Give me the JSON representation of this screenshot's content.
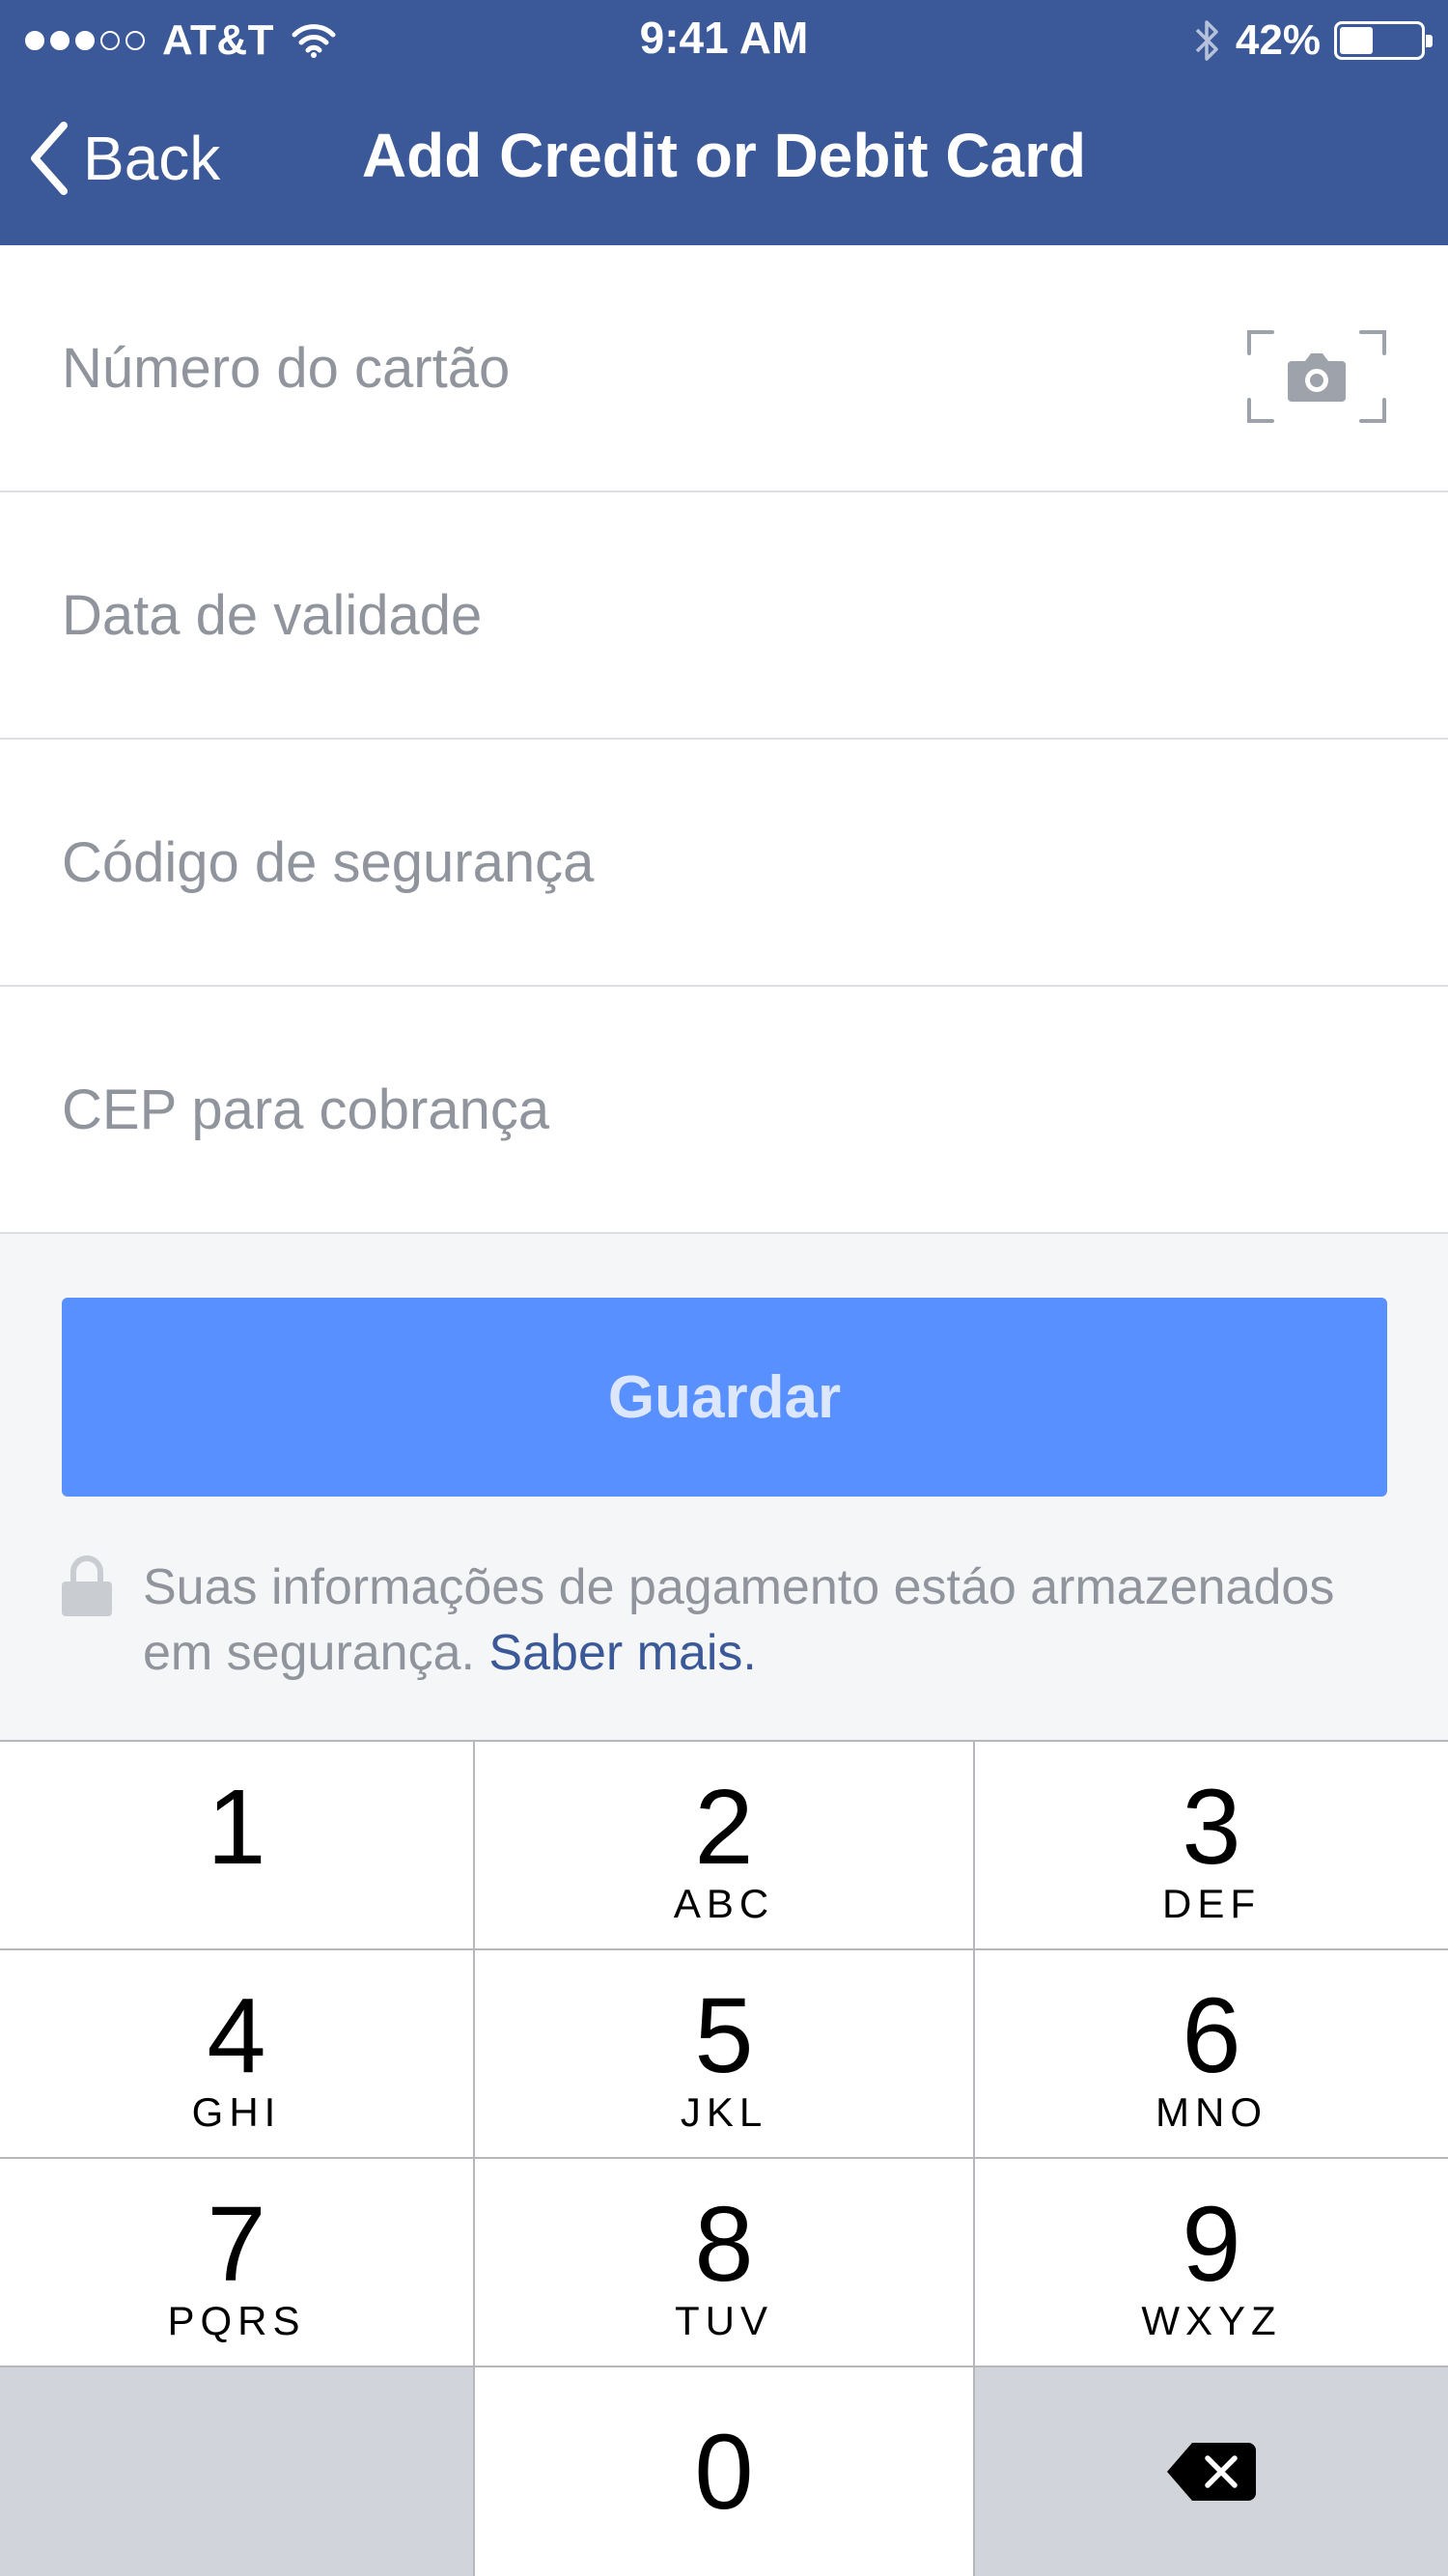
{
  "status_bar": {
    "carrier": "AT&T",
    "time": "9:41 AM",
    "battery_percent": "42%",
    "battery_level": 0.42,
    "signal_bars_filled": 3,
    "signal_bars_total": 5,
    "icons": [
      "wifi-icon",
      "bluetooth-icon",
      "battery-icon"
    ]
  },
  "nav": {
    "back_label": "Back",
    "title": "Add Credit or Debit Card"
  },
  "form": {
    "card_number_placeholder": "Número do cartão",
    "card_number_value": "",
    "expiry_placeholder": "Data de validade",
    "expiry_value": "",
    "security_code_placeholder": "Código de segurança",
    "security_code_value": "",
    "billing_zip_placeholder": "CEP para cobrança",
    "billing_zip_value": "",
    "scan_icon": "camera-scan-icon"
  },
  "actions": {
    "save_label": "Guardar"
  },
  "security_note": {
    "text": "Suas informações de pagamento estáo armazenados em segurança.",
    "link": "Saber mais.",
    "icon": "lock-icon"
  },
  "keypad": {
    "keys": [
      {
        "num": "1",
        "letters": ""
      },
      {
        "num": "2",
        "letters": "ABC"
      },
      {
        "num": "3",
        "letters": "DEF"
      },
      {
        "num": "4",
        "letters": "GHI"
      },
      {
        "num": "5",
        "letters": "JKL"
      },
      {
        "num": "6",
        "letters": "MNO"
      },
      {
        "num": "7",
        "letters": "PQRS"
      },
      {
        "num": "8",
        "letters": "TUV"
      },
      {
        "num": "9",
        "letters": "WXYZ"
      },
      {
        "num": "0",
        "letters": ""
      }
    ],
    "delete_icon": "backspace-icon"
  },
  "colors": {
    "brand_blue": "#3b5998",
    "button_blue": "#5890ff",
    "placeholder_gray": "#90949c",
    "background_gray": "#f5f6f7",
    "keypad_dark": "#d1d4da"
  }
}
